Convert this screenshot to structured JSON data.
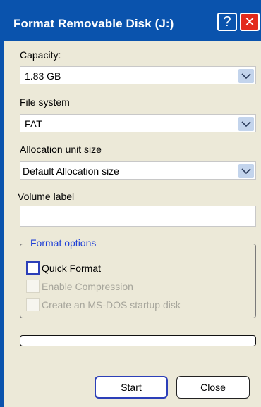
{
  "window": {
    "title": "Format Removable Disk (J:)",
    "help_glyph": "?",
    "close_glyph": "✕"
  },
  "capacity": {
    "label": "Capacity:",
    "value": "1.83 GB"
  },
  "file_system": {
    "label": "File system",
    "value": "FAT"
  },
  "allocation": {
    "label": "Allocation unit size",
    "value": "Default Allocation size"
  },
  "volume": {
    "label": "Volume label",
    "value": ""
  },
  "format_options": {
    "legend": "Format options",
    "quick_format": {
      "label": "Quick Format",
      "checked": false,
      "enabled": true
    },
    "enable_compression": {
      "label": "Enable Compression",
      "checked": false,
      "enabled": false
    },
    "ms_dos": {
      "label": "Create an MS-DOS startup disk",
      "checked": false,
      "enabled": false
    }
  },
  "progress": {
    "fraction": 0
  },
  "buttons": {
    "start": "Start",
    "close": "Close"
  },
  "colors": {
    "titlebar": "#0a53ad",
    "close_button": "#e32b1d",
    "dialog_bg": "#ece9d8",
    "legend_text": "#1e3fd6",
    "focus_border": "#2c3fb8"
  }
}
